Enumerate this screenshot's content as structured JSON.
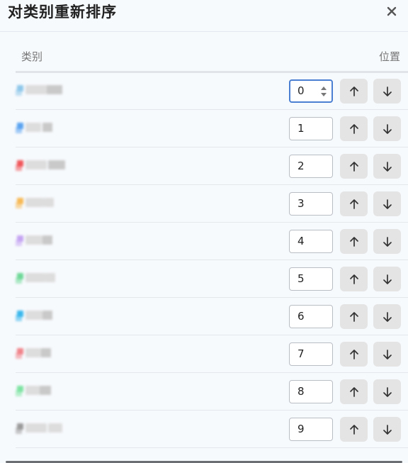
{
  "dialog": {
    "title": "对类别重新排序",
    "close_icon": "close-icon"
  },
  "table": {
    "header_category": "类别",
    "header_position": "位置"
  },
  "rows": [
    {
      "position": "0",
      "color": "#8ec7ea",
      "focused": true
    },
    {
      "position": "1",
      "color": "#5aa3f0"
    },
    {
      "position": "2",
      "color": "#f0565a"
    },
    {
      "position": "3",
      "color": "#f7b955"
    },
    {
      "position": "4",
      "color": "#c5a4f2"
    },
    {
      "position": "5",
      "color": "#6fd898"
    },
    {
      "position": "6",
      "color": "#3ab7ec"
    },
    {
      "position": "7",
      "color": "#f0848a"
    },
    {
      "position": "8",
      "color": "#7ee3a2"
    },
    {
      "position": "9",
      "color": "#9a9a9a"
    }
  ],
  "icons": {
    "up": "arrow-up-icon",
    "down": "arrow-down-icon",
    "spinner": "spinner-icon"
  }
}
